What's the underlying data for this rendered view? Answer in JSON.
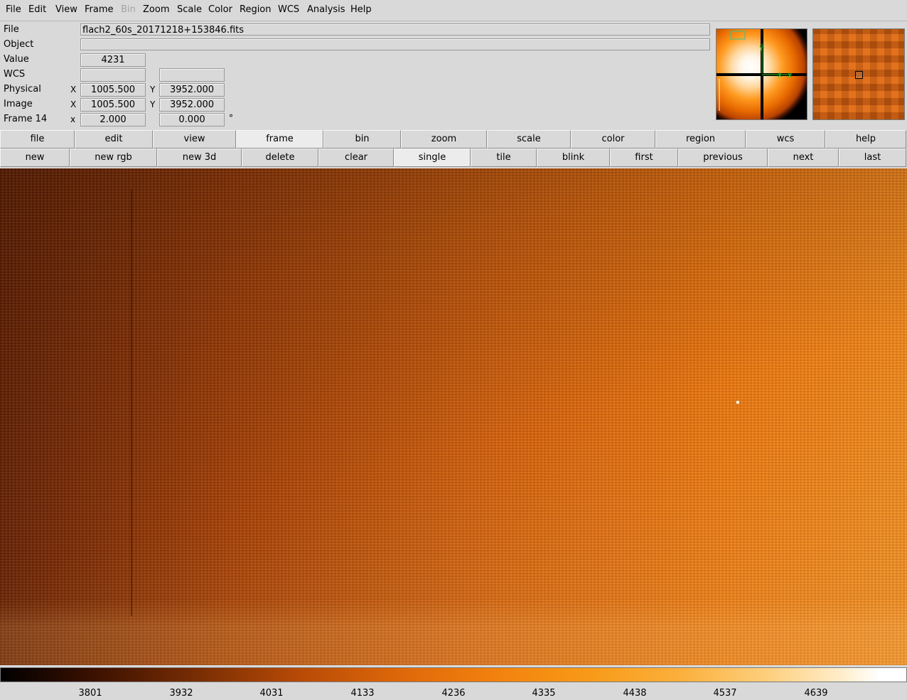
{
  "menubar": {
    "items": [
      "File",
      "Edit",
      "View",
      "Frame",
      "Bin",
      "Zoom",
      "Scale",
      "Color",
      "Region",
      "WCS",
      "Analysis",
      "Help"
    ]
  },
  "info": {
    "file_label": "File",
    "file_value": "flach2_60s_20171218+153846.fits",
    "object_label": "Object",
    "object_value": "",
    "value_label": "Value",
    "value_value": "4231",
    "wcs_label": "WCS",
    "physical_label": "Physical",
    "physical_x": "1005.500",
    "physical_y": "3952.000",
    "image_label": "Image",
    "image_x": "1005.500",
    "image_y": "3952.000",
    "frame_label": "Frame 14",
    "frame_zoom": "2.000",
    "frame_angle": "0.000",
    "axis_x_upper": "X",
    "axis_y_upper": "Y",
    "axis_x_lower": "x",
    "degree_symbol": "°"
  },
  "buttonbar_main": [
    "file",
    "edit",
    "view",
    "frame",
    "bin",
    "zoom",
    "scale",
    "color",
    "region",
    "wcs",
    "help"
  ],
  "buttonbar_main_active": "frame",
  "buttonbar_frame": [
    "new",
    "new rgb",
    "new 3d",
    "delete",
    "clear",
    "single",
    "tile",
    "blink",
    "first",
    "previous",
    "next",
    "last"
  ],
  "buttonbar_frame_active": "single",
  "colorbar": {
    "ticks": [
      "3801",
      "3932",
      "4031",
      "4133",
      "4236",
      "4335",
      "4438",
      "4537",
      "4639"
    ]
  }
}
